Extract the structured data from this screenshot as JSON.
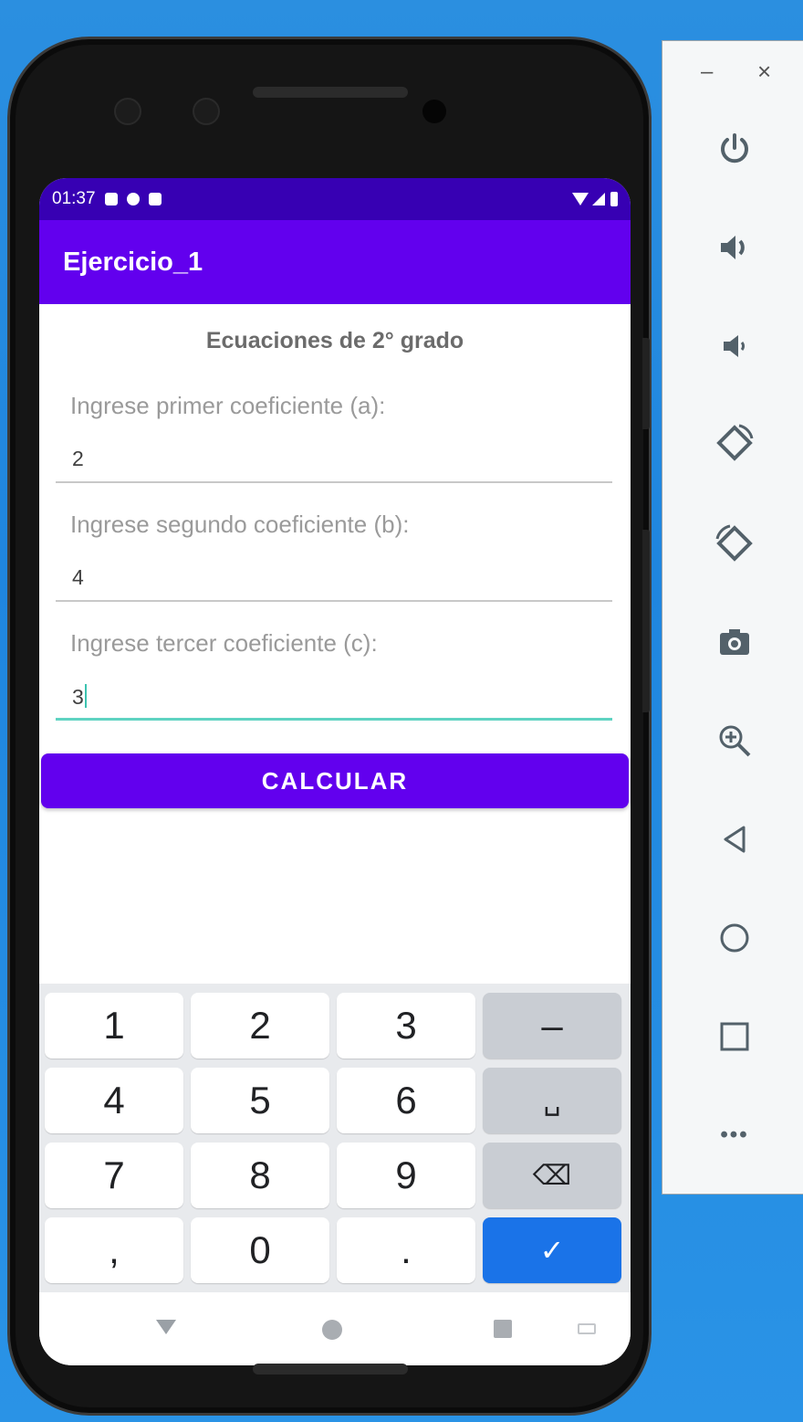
{
  "status_bar": {
    "time": "01:37"
  },
  "app_bar": {
    "title": "Ejercicio_1"
  },
  "form": {
    "heading": "Ecuaciones de 2° grado",
    "fields": [
      {
        "label": "Ingrese primer coeficiente (a):",
        "value": "2"
      },
      {
        "label": "Ingrese segundo coeficiente (b):",
        "value": "4"
      },
      {
        "label": "Ingrese tercer coeficiente (c):",
        "value": "3"
      }
    ],
    "calc_button": "CALCULAR"
  },
  "keyboard": {
    "row1": [
      "1",
      "2",
      "3",
      "–"
    ],
    "row2": [
      "4",
      "5",
      "6",
      "␣"
    ],
    "row3": [
      "7",
      "8",
      "9",
      "⌫"
    ],
    "row4": [
      ",",
      "0",
      ".",
      "✓"
    ]
  },
  "emulator_panel": {
    "minimize": "–",
    "close": "×",
    "controls": [
      "power-icon",
      "volume-up-icon",
      "volume-down-icon",
      "rotate-left-icon",
      "rotate-right-icon",
      "camera-icon",
      "zoom-icon",
      "back-icon",
      "home-icon",
      "overview-icon",
      "more-icon"
    ],
    "more_label": "•••"
  },
  "colors": {
    "primary": "#6200ee",
    "primary_dark": "#3700b3",
    "accent": "#03dac5",
    "keyboard_action": "#1a73e8"
  }
}
